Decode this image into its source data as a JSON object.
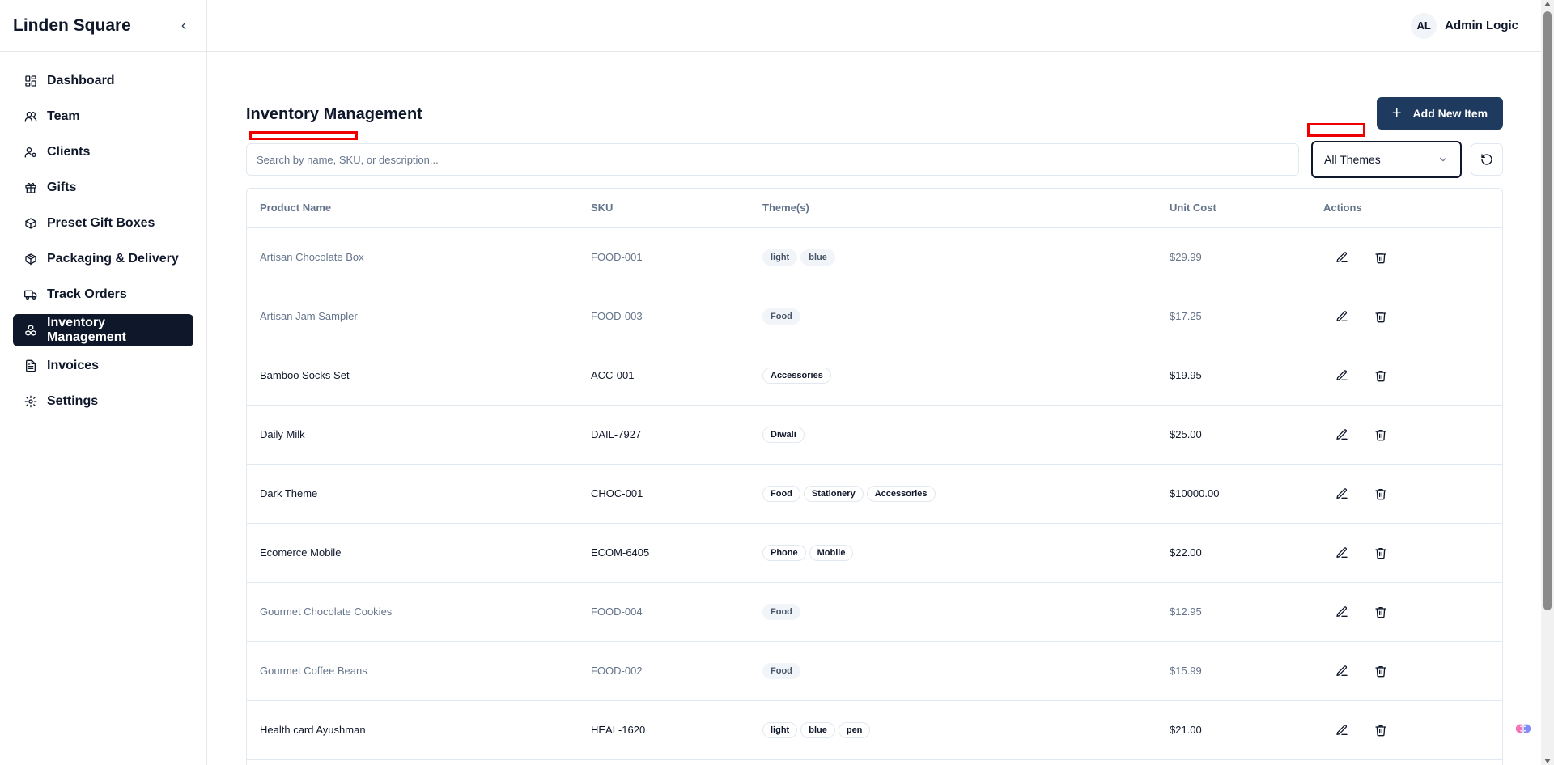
{
  "app": {
    "brand": "Linden Square"
  },
  "sidebar": {
    "items": [
      {
        "label": "Dashboard",
        "icon": "dashboard-icon"
      },
      {
        "label": "Team",
        "icon": "users-icon"
      },
      {
        "label": "Clients",
        "icon": "user-cog-icon"
      },
      {
        "label": "Gifts",
        "icon": "gift-icon"
      },
      {
        "label": "Preset Gift Boxes",
        "icon": "box-icon"
      },
      {
        "label": "Packaging & Delivery",
        "icon": "package-icon"
      },
      {
        "label": "Track Orders",
        "icon": "truck-icon"
      },
      {
        "label": "Inventory Management",
        "icon": "boxes-icon",
        "active": true
      },
      {
        "label": "Invoices",
        "icon": "file-text-icon"
      },
      {
        "label": "Settings",
        "icon": "settings-icon"
      }
    ]
  },
  "header": {
    "avatar_initials": "AL",
    "user_name": "Admin Logic"
  },
  "page": {
    "title": "Inventory Management",
    "add_button": "Add New Item",
    "search_placeholder": "Search by name, SKU, or description...",
    "theme_filter": "All Themes"
  },
  "table": {
    "columns": [
      "Product Name",
      "SKU",
      "Theme(s)",
      "Unit Cost",
      "Actions"
    ],
    "rows": [
      {
        "name": "Artisan Chocolate Box",
        "sku": "FOOD-001",
        "themes": [
          "light",
          "blue"
        ],
        "cost": "$29.99",
        "muted": true
      },
      {
        "name": "Artisan Jam Sampler",
        "sku": "FOOD-003",
        "themes": [
          "Food"
        ],
        "cost": "$17.25",
        "muted": true
      },
      {
        "name": "Bamboo Socks Set",
        "sku": "ACC-001",
        "themes": [
          "Accessories"
        ],
        "cost": "$19.95",
        "muted": false
      },
      {
        "name": "Daily Milk",
        "sku": "DAIL-7927",
        "themes": [
          "Diwali"
        ],
        "cost": "$25.00",
        "muted": false
      },
      {
        "name": "Dark Theme",
        "sku": "CHOC-001",
        "themes": [
          "Food",
          "Stationery",
          "Accessories"
        ],
        "cost": "$10000.00",
        "muted": false
      },
      {
        "name": "Ecomerce Mobile",
        "sku": "ECOM-6405",
        "themes": [
          "Phone",
          "Mobile"
        ],
        "cost": "$22.00",
        "muted": false
      },
      {
        "name": "Gourmet Chocolate Cookies",
        "sku": "FOOD-004",
        "themes": [
          "Food"
        ],
        "cost": "$12.95",
        "muted": true
      },
      {
        "name": "Gourmet Coffee Beans",
        "sku": "FOOD-002",
        "themes": [
          "Food"
        ],
        "cost": "$15.99",
        "muted": true
      },
      {
        "name": "Health card Ayushman",
        "sku": "HEAL-1620",
        "themes": [
          "light",
          "blue",
          "pen"
        ],
        "cost": "$21.00",
        "muted": false
      }
    ]
  },
  "colors": {
    "primary": "#0f172a",
    "button": "#1e3a5f",
    "muted_text": "#64748b",
    "border": "#e2e8f0",
    "marker": "#ef0000"
  }
}
